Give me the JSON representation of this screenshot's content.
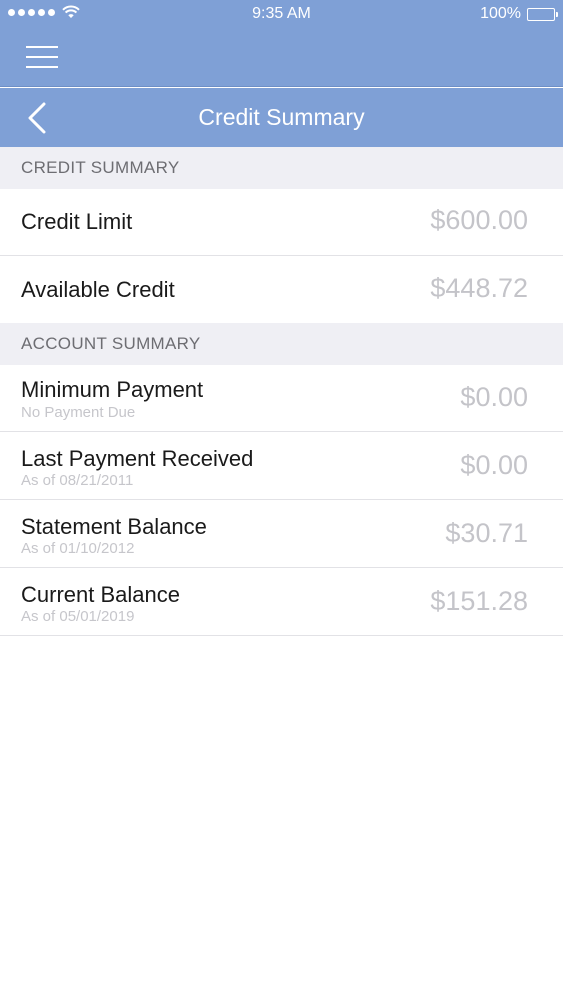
{
  "status_bar": {
    "time": "9:35 AM",
    "battery": "100%"
  },
  "nav": {
    "title": "Credit Summary",
    "back_icon": "chevron-left-icon",
    "menu_icon": "hamburger-menu-icon"
  },
  "colors": {
    "header_blue": "#7fa0d6",
    "section_bg": "#efeff4",
    "value_gray": "#c4c4c9"
  },
  "credit_summary": {
    "header": "CREDIT SUMMARY",
    "rows": [
      {
        "title": "Credit Limit",
        "value": "$600.00"
      },
      {
        "title": "Available Credit",
        "value": "$448.72"
      }
    ]
  },
  "account_summary": {
    "header": "ACCOUNT SUMMARY",
    "rows": [
      {
        "title": "Minimum Payment",
        "sub": "No Payment Due",
        "value": "$0.00"
      },
      {
        "title": "Last Payment Received",
        "sub": "As of 08/21/2011",
        "value": "$0.00"
      },
      {
        "title": "Statement Balance",
        "sub": "As of 01/10/2012",
        "value": "$30.71"
      },
      {
        "title": "Current Balance",
        "sub": "As of 05/01/2019",
        "value": "$151.28"
      }
    ]
  }
}
